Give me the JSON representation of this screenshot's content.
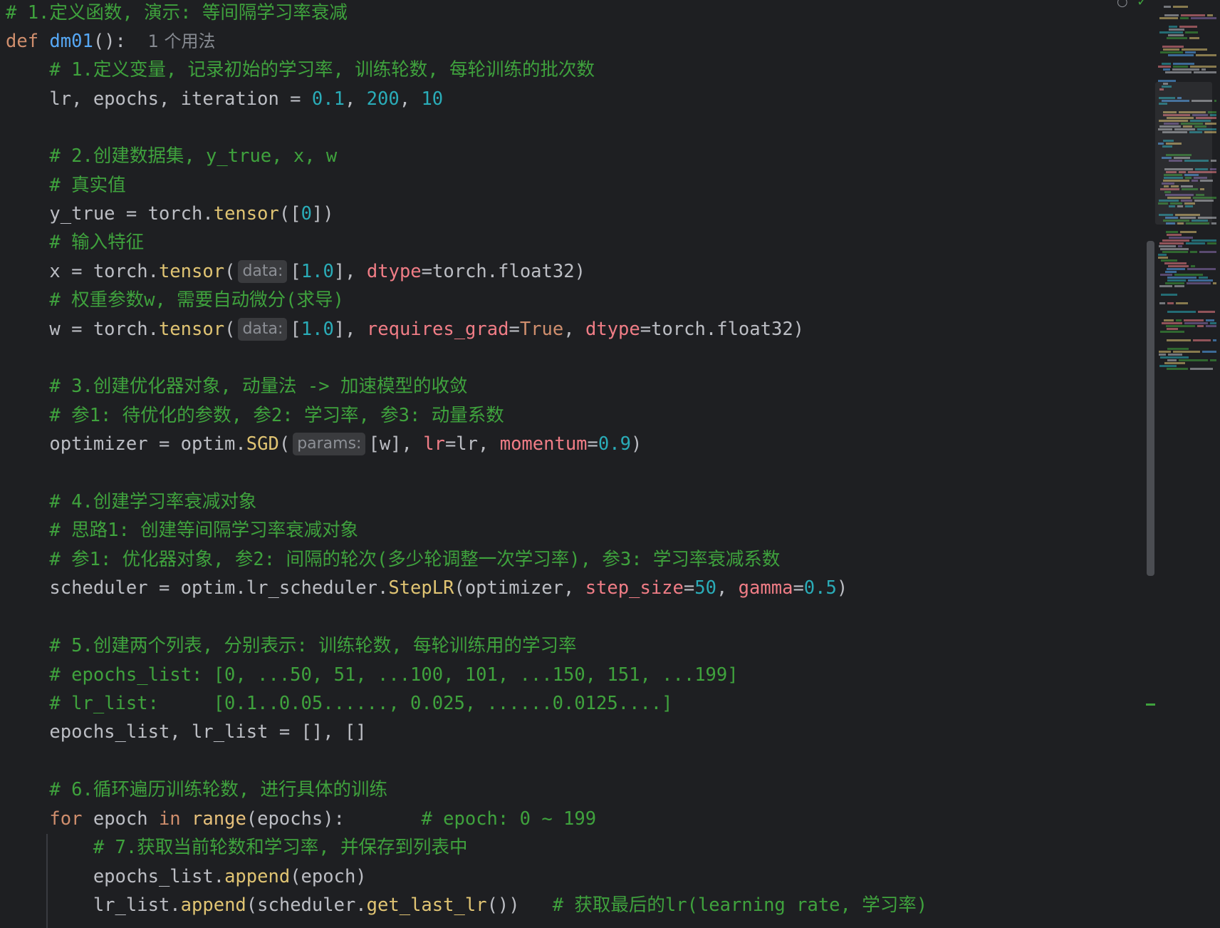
{
  "editor": {
    "usage_hint": "1 个用法",
    "lines": {
      "l0_comment": "# 1.定义函数, 演示: 等间隔学习率衰减",
      "l1_def": "def",
      "l1_name": "dm01",
      "l1_paren": "():",
      "l2_comment": "# 1.定义变量, 记录初始的学习率, 训练轮数, 每轮训练的批次数",
      "l3_a": "lr, epochs, iteration = ",
      "l3_n1": "0.1",
      "l3_n2": "200",
      "l3_n3": "10",
      "l5_comment": "# 2.创建数据集, y_true, x, w",
      "l6_comment": "# 真实值",
      "l7_a": "y_true = torch.",
      "l7_fn": "tensor",
      "l7_b": "([",
      "l7_n": "0",
      "l7_c": "])",
      "l8_comment": "# 输入特征",
      "l9_a": "x = torch.",
      "l9_fn": "tensor",
      "l9_hint": "data:",
      "l9_b": "[",
      "l9_n": "1.0",
      "l9_c": "], ",
      "l9_p": "dtype",
      "l9_d": "=torch.float32)",
      "l10_comment": "# 权重参数w, 需要自动微分(求导)",
      "l11_a": "w = torch.",
      "l11_fn": "tensor",
      "l11_hint": "data:",
      "l11_b": "[",
      "l11_n": "1.0",
      "l11_c": "], ",
      "l11_p1": "requires_grad",
      "l11_e": "=",
      "l11_true": "True",
      "l11_f": ", ",
      "l11_p2": "dtype",
      "l11_d": "=torch.float32)",
      "l13_comment": "# 3.创建优化器对象, 动量法 -> 加速模型的收敛",
      "l14_comment": "# 参1: 待优化的参数, 参2: 学习率, 参3: 动量系数",
      "l15_a": "optimizer = optim.",
      "l15_fn": "SGD",
      "l15_hint": "params:",
      "l15_b": "[w], ",
      "l15_p1": "lr",
      "l15_c": "=lr, ",
      "l15_p2": "momentum",
      "l15_e": "=",
      "l15_n": "0.9",
      "l15_f": ")",
      "l17_comment": "# 4.创建学习率衰减对象",
      "l18_comment": "# 思路1: 创建等间隔学习率衰减对象",
      "l19_comment": "# 参1: 优化器对象, 参2: 间隔的轮次(多少轮调整一次学习率), 参3: 学习率衰减系数",
      "l20_a": "scheduler = optim.lr_scheduler.",
      "l20_fn": "StepLR",
      "l20_b": "(optimizer, ",
      "l20_p1": "step_size",
      "l20_c": "=",
      "l20_n1": "50",
      "l20_d": ", ",
      "l20_p2": "gamma",
      "l20_e": "=",
      "l20_n2": "0.5",
      "l20_f": ")",
      "l22_comment": "# 5.创建两个列表, 分别表示: 训练轮数, 每轮训练用的学习率",
      "l23_comment": "# epochs_list: [0, ...50, 51, ...100, 101, ...150, 151, ...199]",
      "l24_comment": "# lr_list:     [0.1..0.05......, 0.025, ......0.0125....]",
      "l25_a": "epochs_list, lr_list = [], []",
      "l27_comment": "# 6.循环遍历训练轮数, 进行具体的训练",
      "l28_for": "for",
      "l28_a": " epoch ",
      "l28_in": "in",
      "l28_sp": " ",
      "l28_range": "range",
      "l28_b": "(epochs):",
      "l28_comment": "# epoch: 0 ~ 199",
      "l29_comment": "# 7.获取当前轮数和学习率, 并保存到列表中",
      "l30_a": "epochs_list.",
      "l30_fn": "append",
      "l30_b": "(epoch)",
      "l31_a": "lr_list.",
      "l31_fn": "append",
      "l31_b": "(scheduler.",
      "l31_fn2": "get_last_lr",
      "l31_c": "())",
      "l31_comment": "# 获取最后的lr(learning rate, 学习率)"
    }
  },
  "colors": {
    "background": "#1e1f22",
    "comment": "#3fa23d",
    "number": "#2aacb8",
    "keyword": "#cf8e6d",
    "function": "#56a8f5",
    "call": "#e0c473",
    "parameter": "#f07d86"
  },
  "icons": {
    "top_right_1": "eye-slash-icon",
    "top_right_2": "check-icon"
  }
}
